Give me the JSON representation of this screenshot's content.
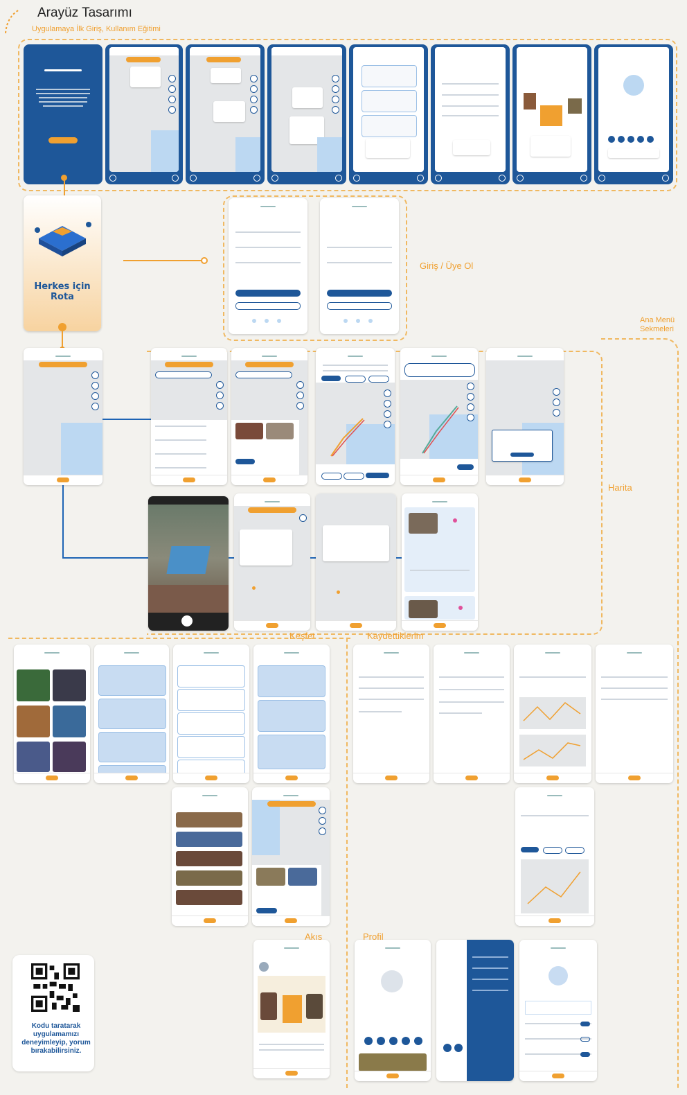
{
  "header": {
    "title": "Arayüz Tasarımı",
    "subtitle": "Uygulamaya İlk Giriş, Kullanım Eğitimi"
  },
  "sections": {
    "login": "Giriş / Üye Ol",
    "main_menu": "Ana Menü\nSekmeleri",
    "map": "Harita",
    "explore": "Keşfet",
    "saved": "Kaydettiklerim",
    "feed": "Akış",
    "profile": "Profil"
  },
  "splash": {
    "brand": "Herkes için Rota"
  },
  "qr": {
    "caption": "Kodu taratarak uygulamamızı deneyimleyip, yorum bırakabilirsiniz."
  },
  "colors": {
    "primary": "#1e5799",
    "accent": "#f0a030",
    "background": "#f3f2ee",
    "map": "#e4e6e8",
    "sea": "#bcd8f2"
  }
}
